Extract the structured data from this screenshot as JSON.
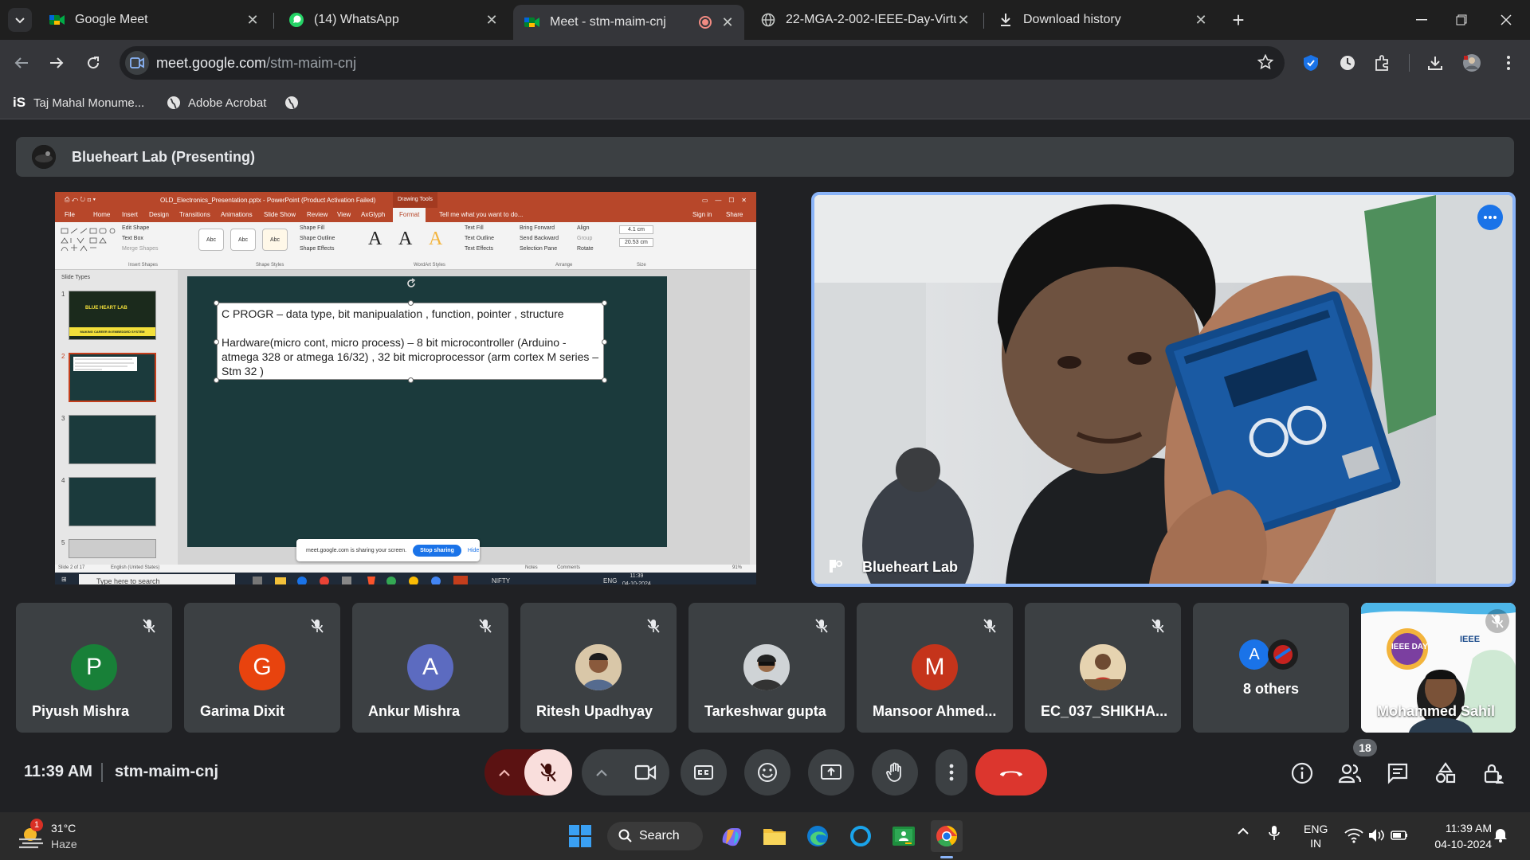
{
  "tabs": [
    {
      "title": "Google Meet",
      "icon": "meet-icon"
    },
    {
      "title": "(14) WhatsApp",
      "icon": "whatsapp-icon"
    },
    {
      "title": "Meet - stm-maim-cnj",
      "icon": "meet-icon",
      "active": true
    },
    {
      "title": "22-MGA-2-002-IEEE-Day-Virtua",
      "icon": "globe-icon"
    },
    {
      "title": "Download history",
      "icon": "download-icon"
    }
  ],
  "address": {
    "host": "meet.google.com",
    "path": "/stm-maim-cnj"
  },
  "bookmarks": [
    {
      "label": "Taj Mahal Monume...",
      "icon": "is-logo"
    },
    {
      "label": "Adobe Acrobat",
      "icon": "globe-icon"
    },
    {
      "label": "",
      "icon": "globe-icon"
    }
  ],
  "presenting": {
    "label": "Blueheart Lab (Presenting)"
  },
  "ppt": {
    "window_title": "OLD_Electronics_Presentation.pptx - PowerPoint (Product Activation Failed)",
    "drawing_tools": "Drawing Tools",
    "ribbon_tabs": [
      "File",
      "Home",
      "Insert",
      "Design",
      "Transitions",
      "Animations",
      "Slide Show",
      "Review",
      "View",
      "AxGlyph",
      "Format"
    ],
    "tell_me": "Tell me what you want to do...",
    "sign_in": "Sign in",
    "share": "Share",
    "ribbon_items": [
      "Edit Shape",
      "Text Box",
      "Merge Shapes",
      "Shape Fill",
      "Shape Outline",
      "Shape Effects",
      "Text Fill",
      "Text Outline",
      "Text Effects",
      "Bring Forward",
      "Send Backward",
      "Selection Pane",
      "Align",
      "Group",
      "Rotate"
    ],
    "groups": [
      "Insert Shapes",
      "Shape Styles",
      "WordArt Styles",
      "Arrange",
      "Size"
    ],
    "size_h": "4.1 cm",
    "size_w": "20.53 cm",
    "abc": "Abc",
    "bigA": "A",
    "slides_header": "Slide Types",
    "slide_numbers": [
      "1",
      "2",
      "3",
      "4",
      "5"
    ],
    "thumb1_title": "BLUE HEART LAB",
    "thumb1_sub": "MAKING CAREER IN EMBEDDED SYSTEM",
    "line1": "C PROGR – data type, bit manipualation , function, pointer , structure",
    "line2": "Hardware(micro cont, micro process) – 8 bit microcontroller (Arduino - atmega 328 or atmega 16/32) , 32 bit microprocessor  (arm cortex M series – Stm 32 )",
    "status_left": "Slide 2 of 17",
    "status_lang": "English (United States)",
    "status_notes": "Notes",
    "status_comments": "Comments",
    "status_zoom": "91%",
    "share_msg": "meet.google.com is sharing your screen.",
    "stop_sharing": "Stop sharing",
    "hide": "Hide",
    "task_search": "Type here to search",
    "task_nifty": "NIFTY",
    "task_eng": "ENG",
    "task_time": "11:39",
    "task_date": "04-10-2024"
  },
  "speaker": {
    "name": "Blueheart Lab"
  },
  "participants": [
    {
      "name": "Piyush Mishra",
      "initial": "P",
      "color": "#188038"
    },
    {
      "name": "Garima Dixit",
      "initial": "G",
      "color": "#e8430e"
    },
    {
      "name": "Ankur Mishra",
      "initial": "A",
      "color": "#5c6bc0"
    },
    {
      "name": "Ritesh Upadhyay",
      "initial": "",
      "color": "#c0a080"
    },
    {
      "name": "Tarkeshwar gupta",
      "initial": "",
      "color": "#808080"
    },
    {
      "name": "Mansoor Ahmed...",
      "initial": "M",
      "color": "#c5341b"
    },
    {
      "name": "EC_037_SHIKHA...",
      "initial": "",
      "color": "#a07050"
    },
    {
      "name": "8 others",
      "initial": "A",
      "color": "#1a73e8"
    },
    {
      "name": "Mohammed Sahil",
      "initial": "",
      "color": "#ffffff"
    }
  ],
  "others_badge_initial": "A",
  "ieee_day": "IEEE DAY",
  "ieee_brand": "IEEE",
  "meeting": {
    "time": "11:39 AM",
    "code": "stm-maim-cnj",
    "people_count": "18"
  },
  "taskbar": {
    "weather_temp": "31°C",
    "weather_cond": "Haze",
    "weather_badge": "1",
    "search": "Search",
    "lang_top": "ENG",
    "lang_bottom": "IN",
    "time": "11:39 AM",
    "date": "04-10-2024"
  }
}
